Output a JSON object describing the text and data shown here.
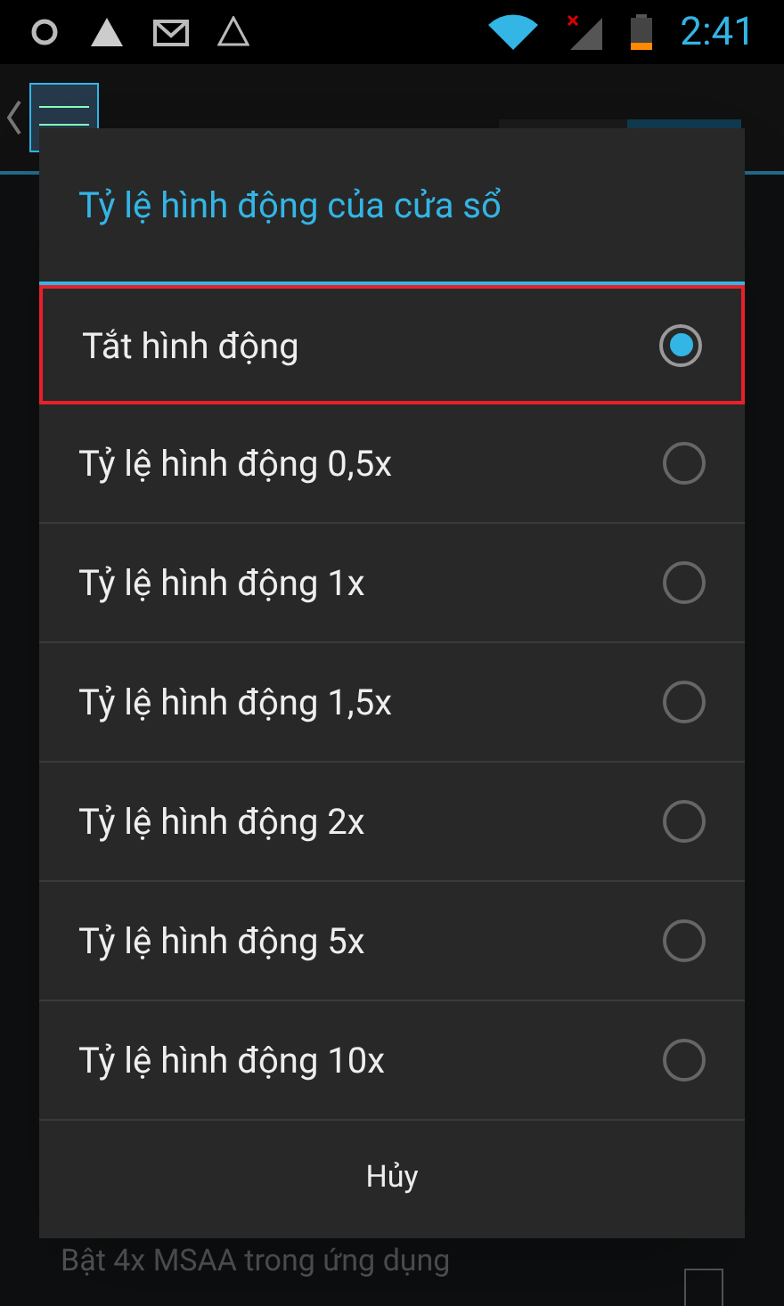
{
  "status_bar": {
    "time": "2:41"
  },
  "action_bar": {
    "toggle_on": true
  },
  "background_setting": {
    "subtitle": "Bật 4x MSAA trong ứng dụng",
    "checked": false
  },
  "dialog": {
    "title": "Tỷ lệ hình động của cửa sổ",
    "options": [
      {
        "label": "Tắt hình động",
        "selected": true,
        "highlighted": true
      },
      {
        "label": "Tỷ lệ hình động 0,5x",
        "selected": false,
        "highlighted": false
      },
      {
        "label": "Tỷ lệ hình động 1x",
        "selected": false,
        "highlighted": false
      },
      {
        "label": "Tỷ lệ hình động 1,5x",
        "selected": false,
        "highlighted": false
      },
      {
        "label": "Tỷ lệ hình động 2x",
        "selected": false,
        "highlighted": false
      },
      {
        "label": "Tỷ lệ hình động 5x",
        "selected": false,
        "highlighted": false
      },
      {
        "label": "Tỷ lệ hình động 10x",
        "selected": false,
        "highlighted": false
      }
    ],
    "cancel": "Hủy"
  }
}
